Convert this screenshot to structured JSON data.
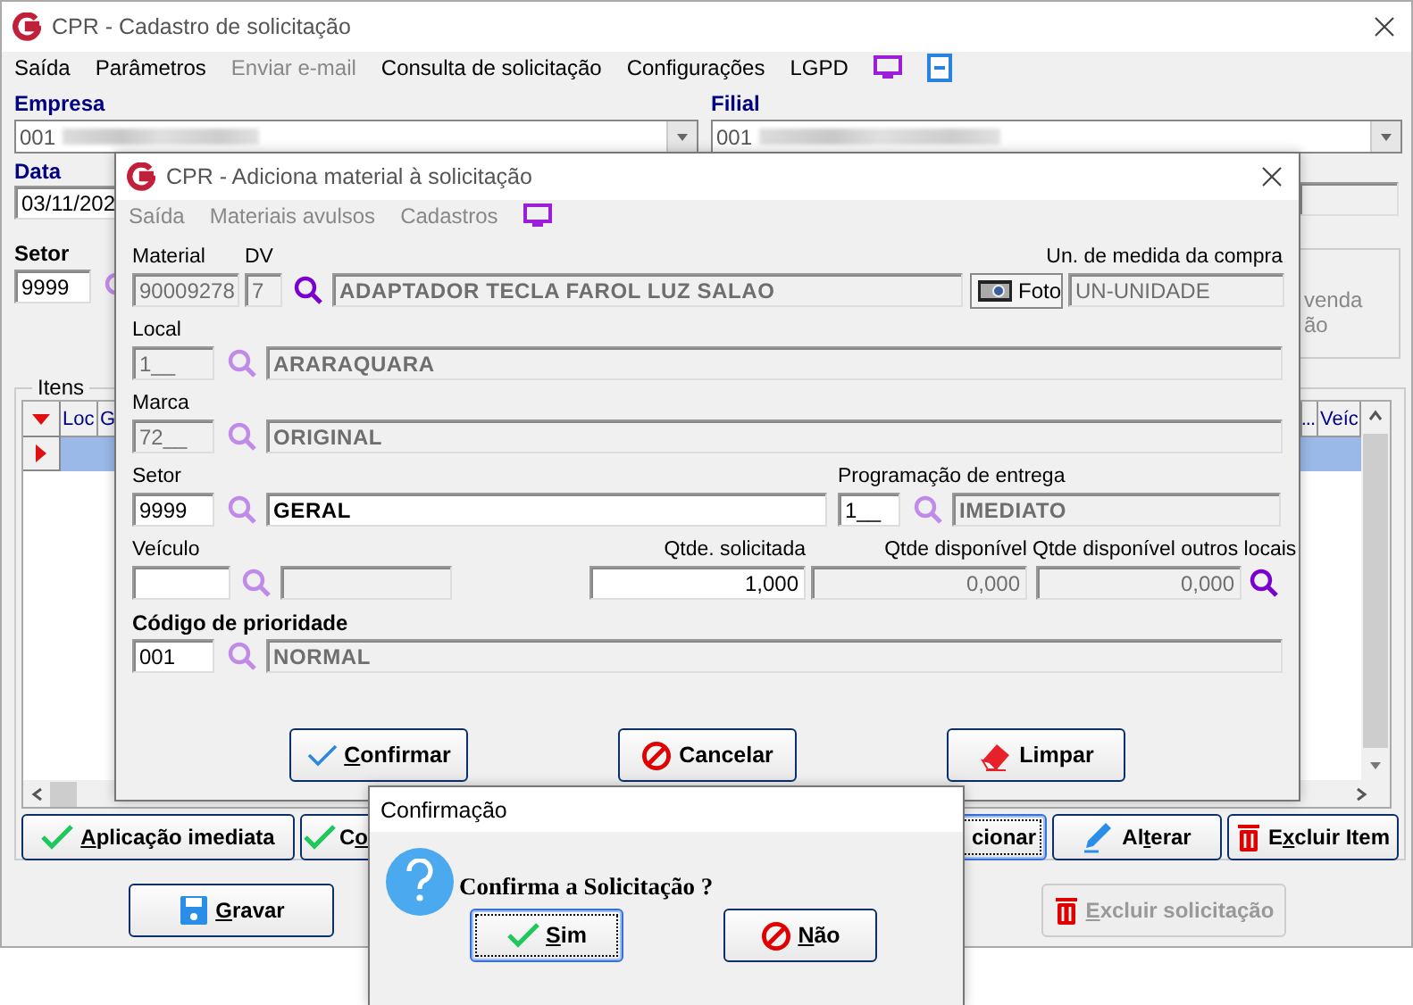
{
  "main_window": {
    "title": "CPR - Cadastro de solicitação",
    "menu": [
      {
        "label": "Saída",
        "disabled": false
      },
      {
        "label": "Parâmetros",
        "disabled": false
      },
      {
        "label": "Enviar e-mail",
        "disabled": true
      },
      {
        "label": "Consulta de solicitação",
        "disabled": false
      },
      {
        "label": "Configurações",
        "disabled": false
      },
      {
        "label": "LGPD",
        "disabled": false
      }
    ],
    "empresa": {
      "label": "Empresa",
      "value": "001"
    },
    "filial": {
      "label": "Filial",
      "value": "001"
    },
    "data": {
      "label": "Data",
      "value": "03/11/202"
    },
    "setor": {
      "label": "Setor",
      "value": "9999"
    },
    "side_panel_texts": [
      "venda",
      "ão"
    ],
    "items": {
      "label": "Itens",
      "columns": [
        "Loc",
        "G",
        "...",
        "Veíc"
      ],
      "rows": [
        {
          "selected": true
        }
      ]
    },
    "item_buttons": [
      {
        "label": "Aplicação imediata",
        "focused": false
      },
      {
        "label": "Co",
        "focused": false
      },
      {
        "label": "cionar",
        "focused": true
      },
      {
        "label": "Alterar",
        "focused": false
      },
      {
        "label": "Excluir Item",
        "focused": false
      }
    ],
    "footer_buttons": [
      {
        "label": "Gravar",
        "disabled": false
      },
      {
        "label": "Excluir solicitação",
        "disabled": true
      }
    ]
  },
  "material_dialog": {
    "title": "CPR - Adiciona material à solicitação",
    "menu": [
      {
        "label": "Saída",
        "disabled": true
      },
      {
        "label": "Materiais avulsos",
        "disabled": true
      },
      {
        "label": "Cadastros",
        "disabled": true
      }
    ],
    "material": {
      "label": "Material",
      "value": "90009278",
      "disabled": true,
      "lookup_enabled": true
    },
    "dv": {
      "label": "DV",
      "value": "7",
      "disabled": true
    },
    "description": {
      "value": "ADAPTADOR  TECLA FAROL LUZ SALAO",
      "disabled": true
    },
    "photo_button": {
      "label": "Foto"
    },
    "unit": {
      "label": "Un. de medida da compra",
      "value": "UN-UNIDADE",
      "disabled": true
    },
    "local": {
      "label": "Local",
      "value": "1__",
      "disabled": true,
      "lookup_enabled": false,
      "description": "ARARAQUARA",
      "description_disabled": true
    },
    "marca": {
      "label": "Marca",
      "value": "72__",
      "disabled": true,
      "lookup_enabled": false,
      "description": "ORIGINAL",
      "description_disabled": true
    },
    "setor": {
      "label": "Setor",
      "value": "9999",
      "disabled": false,
      "lookup_enabled": false,
      "description": "GERAL",
      "description_disabled": false
    },
    "programacao": {
      "label": "Programação de entrega",
      "value": "1__",
      "disabled": false,
      "lookup_enabled": false,
      "description": "IMEDIATO",
      "description_disabled": true
    },
    "veiculo": {
      "label": "Veículo",
      "disabled": false,
      "lookup_enabled": false
    },
    "qtde_solicitada": {
      "label": "Qtde. solicitada",
      "value": "1,000",
      "disabled": false
    },
    "qtde_disponivel": {
      "label": "Qtde disponível",
      "value": "0,000",
      "disabled": true
    },
    "qtde_outros": {
      "label": "Qtde disponível outros locais",
      "value": "0,000",
      "disabled": true,
      "lookup_enabled": true
    },
    "prioridade": {
      "label": "Código de prioridade",
      "value": "001",
      "disabled": false,
      "lookup_enabled": false,
      "description": "NORMAL",
      "description_disabled": true
    },
    "buttons": [
      {
        "label": "Confirmar"
      },
      {
        "label": "Cancelar"
      },
      {
        "label": "Limpar"
      }
    ]
  },
  "confirm_dialog": {
    "title": "Confirmação",
    "message": "Confirma a Solicitação ?",
    "buttons": [
      {
        "label": "Sim",
        "focused": true
      },
      {
        "label": "Não",
        "focused": false
      }
    ]
  }
}
